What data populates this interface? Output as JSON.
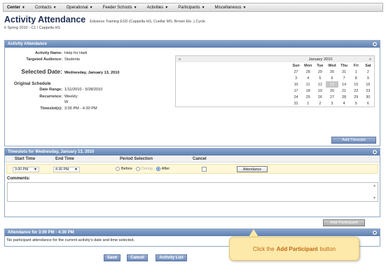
{
  "menu": [
    "Center",
    "Contacts",
    "Operational",
    "Feeder Schools",
    "Activities",
    "Participants",
    "Miscellaneous"
  ],
  "header": {
    "title": "Activity Attendance",
    "subtitle": "Edvance Training ESD (Cappella HS, Cuellar MS, Brown Ele..) Cycle",
    "term": "6 Spring 2010 - C1 / Cappella HS"
  },
  "activity_panel": {
    "title": "Activity Attendance",
    "activity_name_label": "Activity Name:",
    "activity_name": "Help for Haiti",
    "audience_label": "Targeted Audience:",
    "audience": "Students",
    "selected_date_label": "Selected Date:",
    "selected_date": "Wednesday, January 13, 2010",
    "original_schedule_label": "Original Schedule",
    "date_range_label": "Date Range:",
    "date_range": "1/11/2010 - 5/28/2010",
    "recurrence_label": "Recurrence:",
    "recurrence": "Weekly:",
    "recurrence_day": "W",
    "timeslots_label": "Timeslot(s):",
    "timeslots": "3:00 PM - 4:30 PM",
    "add_timeslot": "Add Timeslot"
  },
  "calendar": {
    "prev": "«",
    "next": "»",
    "month": "January 2010",
    "days": [
      "Sun",
      "Mon",
      "Tue",
      "Wed",
      "Thu",
      "Fri",
      "Sat"
    ],
    "weeks": [
      [
        "27",
        "28",
        "29",
        "30",
        "31",
        "1",
        "2"
      ],
      [
        "3",
        "4",
        "5",
        "6",
        "7",
        "8",
        "9"
      ],
      [
        "10",
        "11",
        "12",
        "13",
        "14",
        "15",
        "16"
      ],
      [
        "17",
        "18",
        "19",
        "20",
        "21",
        "22",
        "23"
      ],
      [
        "24",
        "25",
        "26",
        "27",
        "28",
        "29",
        "30"
      ],
      [
        "31",
        "1",
        "2",
        "3",
        "4",
        "5",
        "6"
      ]
    ],
    "selected": "13"
  },
  "timeslots_panel": {
    "title": "Timeslots for Wednesday, January 13, 2010",
    "col_start": "Start Time",
    "col_end": "End Time",
    "col_period": "Period Selection",
    "col_cancel": "Cancel",
    "start": "3:00 PM",
    "end": "4:30 PM",
    "before": "Before",
    "during": "During",
    "after": "After",
    "attendance_btn": "Attendance",
    "comments_label": "Comments:",
    "add_participant": "Add Participant"
  },
  "attendance_panel": {
    "title": "Attendance for 3:00 PM - 4:30 PM",
    "message": "No participant attendance for the current activity's date and time selected."
  },
  "buttons": {
    "save": "Save",
    "cancel": "Cancel",
    "activity_list": "Activity List"
  },
  "tooltip": {
    "prefix": "Click the",
    "bold": "Add Participant",
    "suffix": "button"
  },
  "colors": {
    "panel_header": "#6f8cb9",
    "title": "#1e2f55",
    "highlight_row": "#fef8d9",
    "tooltip_bg": "#fde9a9",
    "tooltip_text": "#c16612"
  }
}
